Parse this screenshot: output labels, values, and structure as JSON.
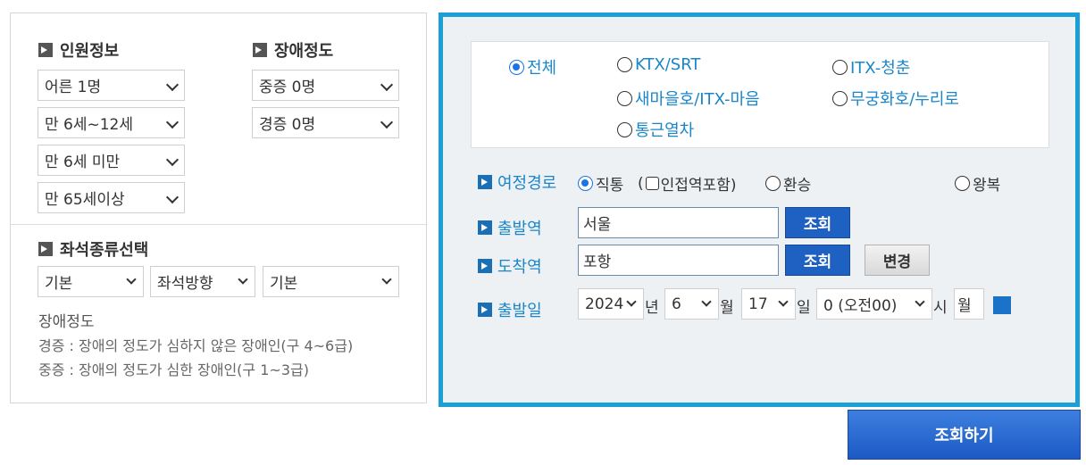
{
  "left": {
    "passenger_title": "인원정보",
    "disability_title": "장애정도",
    "passengers": [
      "어른 1명",
      "만 6세~12세",
      "만 6세 미만",
      "만 65세이상"
    ],
    "disability": [
      "중증 0명",
      "경증 0명"
    ],
    "seat_title": "좌석종류선택",
    "seat_options": [
      "기본",
      "좌석방향",
      "기본"
    ],
    "note_title": "장애정도",
    "note_lines": [
      "경증 : 장애의 정도가 심하지 않은 장애인(구 4~6급)",
      "중증 : 장애의 정도가 심한 장애인(구 1~3급)"
    ]
  },
  "trains": {
    "all": "전체",
    "ktx": "KTX/SRT",
    "itx_cheongchun": "ITX-청춘",
    "saemaeul": "새마을호/ITX-마음",
    "mugunghwa": "무궁화호/누리로",
    "commuter": "통근열차",
    "selected": "전체"
  },
  "route": {
    "label": "여정경로",
    "direct": "직통",
    "include_nearby_open": "(",
    "include_nearby": "인접역포함)",
    "transfer": "환승",
    "round_trip": "왕복",
    "selected": "직통"
  },
  "departure": {
    "label": "출발역",
    "value": "서울",
    "search_label": "조회"
  },
  "arrival": {
    "label": "도착역",
    "value": "포항",
    "search_label": "조회",
    "change_label": "변경"
  },
  "date": {
    "label": "출발일",
    "year": "2024",
    "year_unit": "년",
    "month": "6",
    "month_unit": "월",
    "day": "17",
    "day_unit": "일",
    "hour": "0 (오전00)",
    "hour_unit": "시",
    "weekday": "월"
  },
  "submit_label": "조회하기",
  "colors": {
    "accent_border": "#1aa0d6",
    "button_blue": "#1f61c2",
    "label_blue": "#1a86c8"
  }
}
